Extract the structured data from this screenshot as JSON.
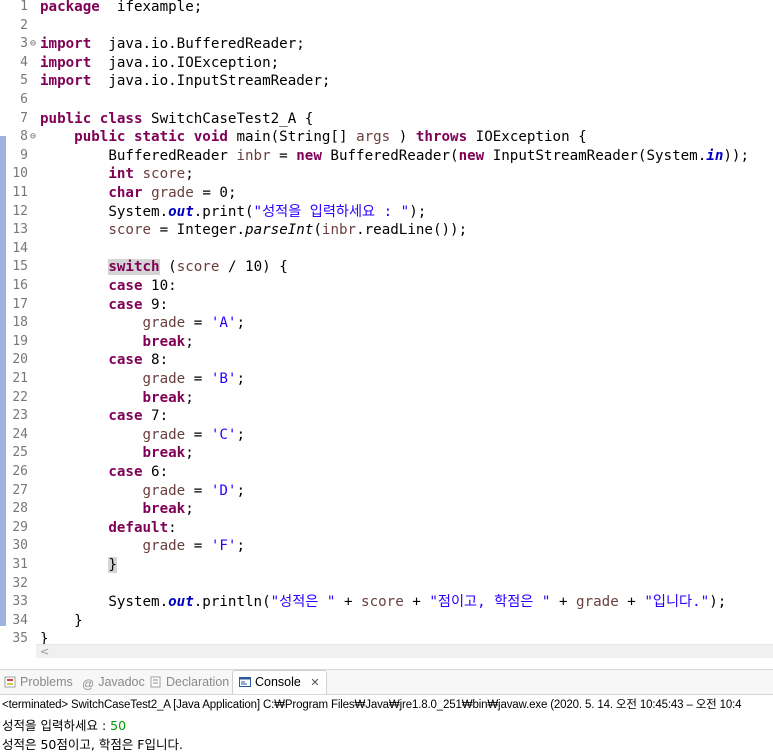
{
  "editor": {
    "lines": [
      {
        "n": "1",
        "t": [
          [
            "kw",
            "package"
          ],
          [
            "",
            "  ifexample;"
          ]
        ]
      },
      {
        "n": "2",
        "t": []
      },
      {
        "n": "3",
        "fold": "⊖",
        "t": [
          [
            "kw",
            "import"
          ],
          [
            "",
            "  java.io.BufferedReader;"
          ]
        ]
      },
      {
        "n": "4",
        "t": [
          [
            "kw",
            "import"
          ],
          [
            "",
            "  java.io.IOException;"
          ]
        ]
      },
      {
        "n": "5",
        "t": [
          [
            "kw",
            "import"
          ],
          [
            "",
            "  java.io.InputStreamReader;"
          ]
        ]
      },
      {
        "n": "6",
        "t": []
      },
      {
        "n": "7",
        "t": [
          [
            "kw",
            "public"
          ],
          [
            "",
            " "
          ],
          [
            "kw",
            "class"
          ],
          [
            "",
            " SwitchCaseTest2_A {"
          ]
        ]
      },
      {
        "n": "8",
        "fold": "⊖",
        "t": [
          [
            "",
            "    "
          ],
          [
            "kw",
            "public"
          ],
          [
            "",
            " "
          ],
          [
            "kw",
            "static"
          ],
          [
            "",
            " "
          ],
          [
            "kw",
            "void"
          ],
          [
            "",
            " main(String[] "
          ],
          [
            "local",
            "args"
          ],
          [
            "",
            " ) "
          ],
          [
            "kw",
            "throws"
          ],
          [
            "",
            " IOException {"
          ]
        ]
      },
      {
        "n": "9",
        "t": [
          [
            "",
            "        BufferedReader "
          ],
          [
            "local",
            "inbr"
          ],
          [
            "",
            " = "
          ],
          [
            "kw",
            "new"
          ],
          [
            "",
            " BufferedReader("
          ],
          [
            "kw",
            "new"
          ],
          [
            "",
            " InputStreamReader(System."
          ],
          [
            "field",
            "in"
          ],
          [
            "",
            "));"
          ]
        ]
      },
      {
        "n": "10",
        "t": [
          [
            "",
            "        "
          ],
          [
            "kw",
            "int"
          ],
          [
            "",
            " "
          ],
          [
            "local",
            "score"
          ],
          [
            "",
            ";"
          ]
        ]
      },
      {
        "n": "11",
        "t": [
          [
            "",
            "        "
          ],
          [
            "kw",
            "char"
          ],
          [
            "",
            " "
          ],
          [
            "local",
            "grade"
          ],
          [
            "",
            " = 0;"
          ]
        ]
      },
      {
        "n": "12",
        "t": [
          [
            "",
            "        System."
          ],
          [
            "field",
            "out"
          ],
          [
            "",
            ".print("
          ],
          [
            "str",
            "\"성적을 입력하세요 : \""
          ],
          [
            "",
            ");"
          ]
        ]
      },
      {
        "n": "13",
        "t": [
          [
            "",
            "        "
          ],
          [
            "local",
            "score"
          ],
          [
            "",
            " = Integer."
          ],
          [
            "stat",
            "parseInt"
          ],
          [
            "",
            "("
          ],
          [
            "local",
            "inbr"
          ],
          [
            "",
            ".readLine());"
          ]
        ]
      },
      {
        "n": "14",
        "t": []
      },
      {
        "n": "15",
        "t": [
          [
            "",
            "        "
          ],
          [
            "kwhl",
            "switch"
          ],
          [
            "",
            " ("
          ],
          [
            "local",
            "score"
          ],
          [
            "",
            " / 10) {"
          ]
        ]
      },
      {
        "n": "16",
        "t": [
          [
            "",
            "        "
          ],
          [
            "kw",
            "case"
          ],
          [
            "",
            " 10:"
          ]
        ]
      },
      {
        "n": "17",
        "t": [
          [
            "",
            "        "
          ],
          [
            "kw",
            "case"
          ],
          [
            "",
            " 9:"
          ]
        ]
      },
      {
        "n": "18",
        "t": [
          [
            "",
            "            "
          ],
          [
            "local",
            "grade"
          ],
          [
            "",
            " = "
          ],
          [
            "str",
            "'A'"
          ],
          [
            "",
            ";"
          ]
        ]
      },
      {
        "n": "19",
        "t": [
          [
            "",
            "            "
          ],
          [
            "kw",
            "break"
          ],
          [
            "",
            ";"
          ]
        ]
      },
      {
        "n": "20",
        "t": [
          [
            "",
            "        "
          ],
          [
            "kw",
            "case"
          ],
          [
            "",
            " 8:"
          ]
        ]
      },
      {
        "n": "21",
        "t": [
          [
            "",
            "            "
          ],
          [
            "local",
            "grade"
          ],
          [
            "",
            " = "
          ],
          [
            "str",
            "'B'"
          ],
          [
            "",
            ";"
          ]
        ]
      },
      {
        "n": "22",
        "t": [
          [
            "",
            "            "
          ],
          [
            "kw",
            "break"
          ],
          [
            "",
            ";"
          ]
        ]
      },
      {
        "n": "23",
        "t": [
          [
            "",
            "        "
          ],
          [
            "kw",
            "case"
          ],
          [
            "",
            " 7:"
          ]
        ]
      },
      {
        "n": "24",
        "t": [
          [
            "",
            "            "
          ],
          [
            "local",
            "grade"
          ],
          [
            "",
            " = "
          ],
          [
            "str",
            "'C'"
          ],
          [
            "",
            ";"
          ]
        ]
      },
      {
        "n": "25",
        "t": [
          [
            "",
            "            "
          ],
          [
            "kw",
            "break"
          ],
          [
            "",
            ";"
          ]
        ]
      },
      {
        "n": "26",
        "t": [
          [
            "",
            "        "
          ],
          [
            "kw",
            "case"
          ],
          [
            "",
            " 6:"
          ]
        ]
      },
      {
        "n": "27",
        "t": [
          [
            "",
            "            "
          ],
          [
            "local",
            "grade"
          ],
          [
            "",
            " = "
          ],
          [
            "str",
            "'D'"
          ],
          [
            "",
            ";"
          ]
        ]
      },
      {
        "n": "28",
        "t": [
          [
            "",
            "            "
          ],
          [
            "kw",
            "break"
          ],
          [
            "",
            ";"
          ]
        ]
      },
      {
        "n": "29",
        "t": [
          [
            "",
            "        "
          ],
          [
            "kw",
            "default"
          ],
          [
            "",
            ":"
          ]
        ]
      },
      {
        "n": "30",
        "t": [
          [
            "",
            "            "
          ],
          [
            "local",
            "grade"
          ],
          [
            "",
            " = "
          ],
          [
            "str",
            "'F'"
          ],
          [
            "",
            ";"
          ]
        ]
      },
      {
        "n": "31",
        "t": [
          [
            "",
            "        "
          ],
          [
            "hl",
            "}"
          ]
        ]
      },
      {
        "n": "32",
        "t": []
      },
      {
        "n": "33",
        "t": [
          [
            "",
            "        System."
          ],
          [
            "field",
            "out"
          ],
          [
            "",
            ".println("
          ],
          [
            "str",
            "\"성적은 \""
          ],
          [
            "",
            " + "
          ],
          [
            "local",
            "score"
          ],
          [
            "",
            " + "
          ],
          [
            "str",
            "\"점이고, 학점은 \""
          ],
          [
            "",
            " + "
          ],
          [
            "local",
            "grade"
          ],
          [
            "",
            " + "
          ],
          [
            "str",
            "\"입니다.\""
          ],
          [
            "",
            ");"
          ]
        ]
      },
      {
        "n": "34",
        "t": [
          [
            "",
            "    }"
          ]
        ]
      },
      {
        "n": "35",
        "t": [
          [
            "",
            "}"
          ]
        ]
      }
    ],
    "scroll_left_glyph": "<"
  },
  "panel": {
    "tabs": [
      {
        "label": "Problems",
        "icon": "problems-icon"
      },
      {
        "label": "Javadoc",
        "icon": "javadoc-icon"
      },
      {
        "label": "Declaration",
        "icon": "declaration-icon"
      },
      {
        "label": "Console",
        "icon": "console-icon",
        "active": true
      }
    ],
    "close_glyph": "✕",
    "status": "<terminated> SwitchCaseTest2_A [Java Application] C:₩Program Files₩Java₩jre1.8.0_251₩bin₩javaw.exe  (2020. 5. 14. 오전 10:45:43 – 오전 10:4",
    "output": {
      "prompt": "성적을 입력하세요 : ",
      "input": "50",
      "result": "성적은 50점이고, 학점은 F입니다."
    }
  },
  "colors": {
    "keyword": "#7f0055",
    "string": "#2a00ff",
    "field": "#0000c0",
    "local": "#6a3e3e",
    "input": "#009900"
  }
}
